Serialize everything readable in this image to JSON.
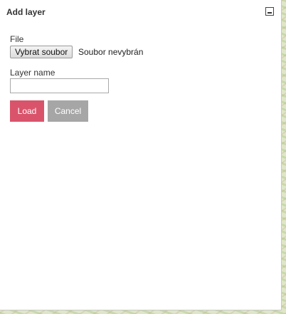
{
  "panel": {
    "title": "Add layer",
    "minimize_icon": "minimize-icon"
  },
  "form": {
    "file_label": "File",
    "file_button_label": "Vybrat soubor",
    "file_status": "Soubor nevybrán",
    "layer_name_label": "Layer name",
    "layer_name_value": "",
    "load_label": "Load",
    "cancel_label": "Cancel"
  },
  "colors": {
    "load_button": "#d9546b",
    "cancel_button": "#a6a6a6"
  }
}
